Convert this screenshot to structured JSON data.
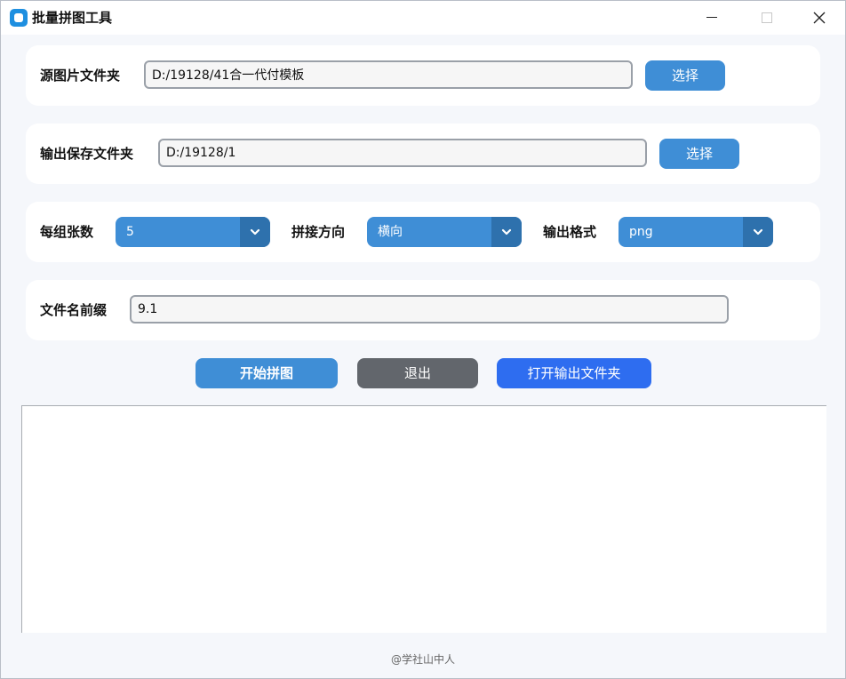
{
  "window": {
    "title": "批量拼图工具"
  },
  "source": {
    "label": "源图片文件夹",
    "value": "D:/19128/41合一代付模板",
    "button_label": "选择"
  },
  "output": {
    "label": "输出保存文件夹",
    "value": "D:/19128/1",
    "button_label": "选择"
  },
  "options": {
    "per_group_label": "每组张数",
    "per_group_value": "5",
    "direction_label": "拼接方向",
    "direction_value": "横向",
    "format_label": "输出格式",
    "format_value": "png"
  },
  "prefix": {
    "label": "文件名前缀",
    "value": "9.1"
  },
  "actions": {
    "start_label": "开始拼图",
    "exit_label": "退出",
    "open_folder_label": "打开输出文件夹"
  },
  "footer": {
    "text": "@学社山中人"
  },
  "colors": {
    "primary": "#3f8ed6",
    "primary_dark": "#2e71ad",
    "exit": "#62666c",
    "open_folder": "#2e6df0",
    "background": "#f5f7fb"
  },
  "icons": {
    "app": "app-icon",
    "dropdown": "chevron-down-icon",
    "close": "close-icon"
  }
}
